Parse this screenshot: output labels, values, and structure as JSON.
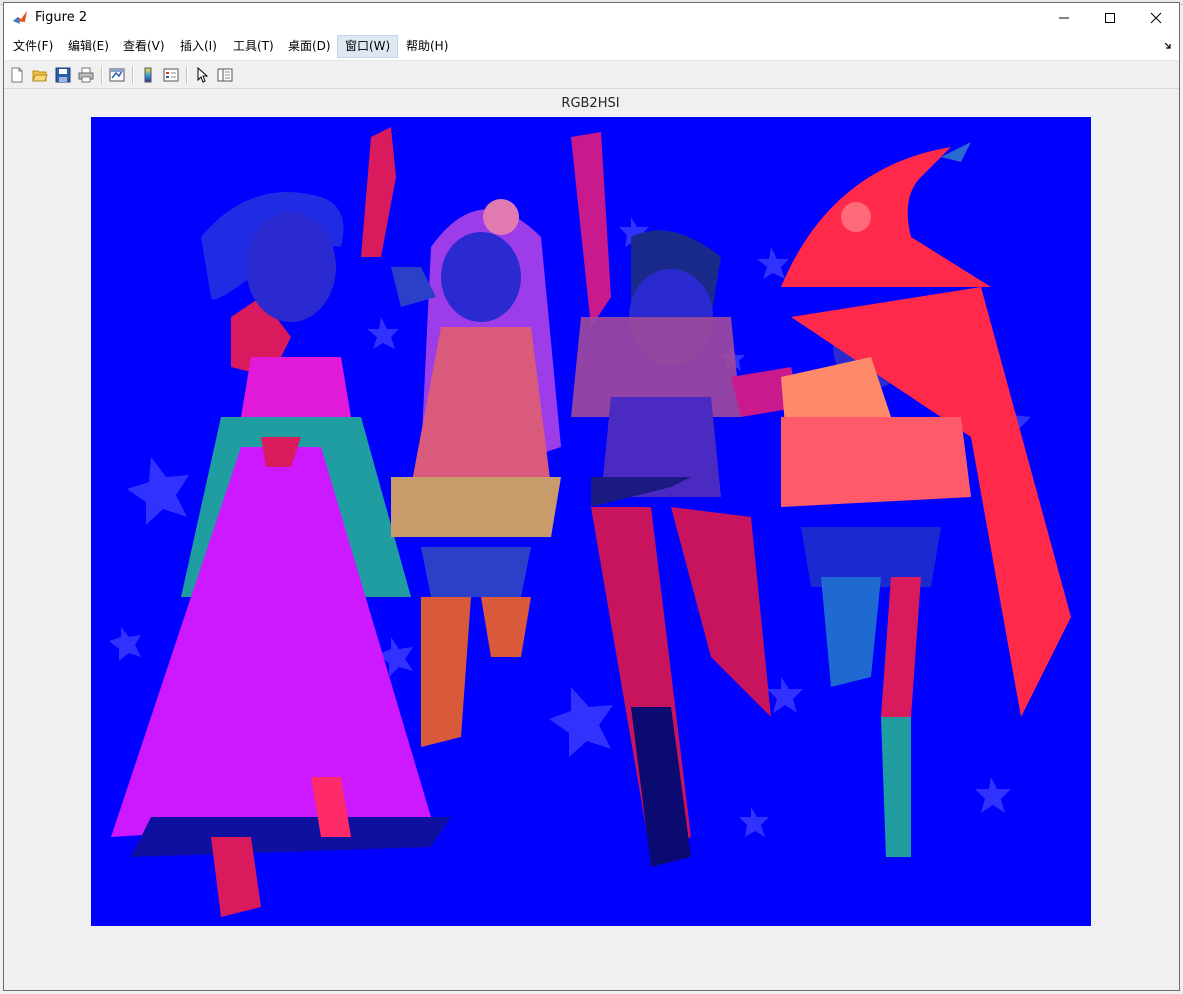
{
  "window": {
    "title": "Figure 2",
    "controls": {
      "minimize": "minimize",
      "maximize": "maximize",
      "close": "close"
    }
  },
  "menubar": {
    "items": [
      {
        "label": "文件(F)"
      },
      {
        "label": "编辑(E)"
      },
      {
        "label": "查看(V)"
      },
      {
        "label": "插入(I)"
      },
      {
        "label": "工具(T)"
      },
      {
        "label": "桌面(D)"
      },
      {
        "label": "窗口(W)",
        "active": true
      },
      {
        "label": "帮助(H)"
      }
    ]
  },
  "toolbar": {
    "buttons": [
      "new-figure-icon",
      "open-file-icon",
      "save-icon",
      "print-icon",
      "link-plot-icon",
      "colorbar-icon",
      "legend-icon",
      "edit-plot-cursor-icon",
      "property-inspector-icon"
    ]
  },
  "axes": {
    "title": "RGB2HSI",
    "image_background": "#0000ff"
  },
  "colors": {
    "accent_active_menu": "#dde8f3",
    "plot_blue": "#0000ff",
    "magenta": "#cc19ff",
    "teal": "#1f9da0",
    "red": "#ff2a4a",
    "pink": "#ff5a8a"
  }
}
